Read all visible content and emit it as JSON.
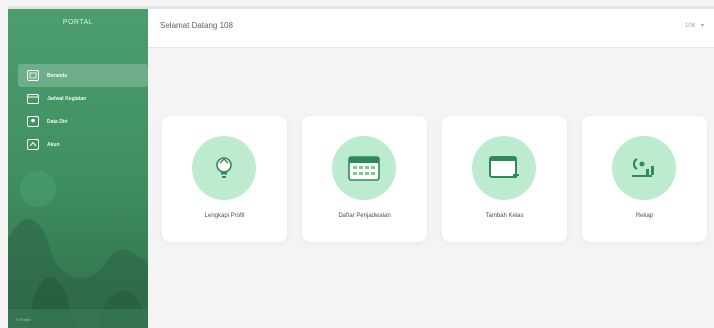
{
  "sidebar": {
    "brand": "PORTAL",
    "menu": [
      {
        "label": "Beranda",
        "icon": "home-icon"
      },
      {
        "label": "Jadwal Kegiatan",
        "icon": "calendar-icon"
      },
      {
        "label": "Data Diri",
        "icon": "user-icon"
      },
      {
        "label": "Akun",
        "icon": "account-icon"
      }
    ],
    "footer": "© Portal"
  },
  "header": {
    "greeting": "Selamat Datang 108",
    "user_badge": "108",
    "caret": "▾"
  },
  "cards": [
    {
      "label": "Lengkapi Profil",
      "icon": "lightbulb-icon"
    },
    {
      "label": "Daftar Penjadwalan",
      "icon": "calendar-grid-icon"
    },
    {
      "label": "Tambah Kelas",
      "icon": "window-add-icon"
    },
    {
      "label": "Rekap",
      "icon": "report-icon"
    }
  ],
  "colors": {
    "sidebar_green": "#3e8e60",
    "accent_green": "#2e8b57",
    "circle_bg": "#bdebcf"
  }
}
